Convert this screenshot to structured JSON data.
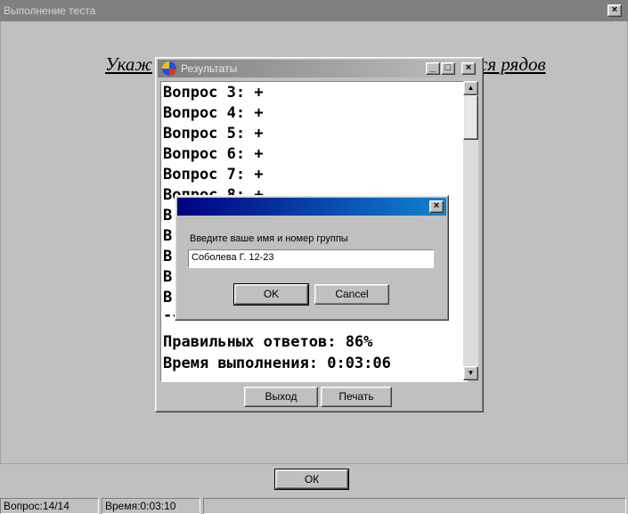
{
  "main_window": {
    "title": "Выполнение теста",
    "question_visible_start": "Укаж",
    "question_visible_end": "ся рядов",
    "ok_label": "ОК"
  },
  "results_window": {
    "title": "Результаты",
    "lines": [
      "Вопрос 3: +",
      "Вопрос 4: +",
      "Вопрос 5: +",
      "Вопрос 6: +",
      "Вопрос 7: +"
    ],
    "partial_line": "Вопрос 8: +",
    "hidden_lines": [
      "В",
      "В",
      "В",
      "В",
      "В"
    ],
    "separator": "---------------------------------",
    "correct_label": "Правильных ответов: 86%",
    "time_label": "Время выполнения: 0:03:06",
    "exit_label": "Выход",
    "print_label": "Печать"
  },
  "input_dialog": {
    "prompt": "Введите ваше имя и номер группы",
    "value": "Соболева Г. 12-23",
    "ok_label": "OK",
    "cancel_label": "Cancel"
  },
  "status_bar": {
    "question": "Вопрос:14/14",
    "time": "Время:0:03:10"
  },
  "icons": {
    "close": "×",
    "minimize": "_",
    "maximize": "□",
    "scroll_up": "▲",
    "scroll_down": "▼"
  }
}
